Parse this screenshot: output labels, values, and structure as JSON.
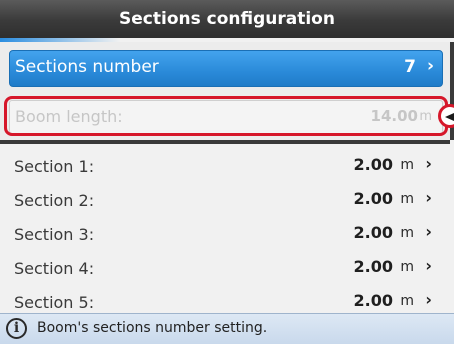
{
  "header": {
    "title": "Sections configuration"
  },
  "sections_number": {
    "label": "Sections number",
    "value": "7",
    "chevron": "›"
  },
  "boom_length": {
    "label": "Boom length:",
    "value": "14.00",
    "unit": "m"
  },
  "sections": [
    {
      "label": "Section 1:",
      "value": "2.00",
      "unit": "m",
      "chevron": "›"
    },
    {
      "label": "Section 2:",
      "value": "2.00",
      "unit": "m",
      "chevron": "›"
    },
    {
      "label": "Section 3:",
      "value": "2.00",
      "unit": "m",
      "chevron": "›"
    },
    {
      "label": "Section 4:",
      "value": "2.00",
      "unit": "m",
      "chevron": "›"
    },
    {
      "label": "Section 5:",
      "value": "2.00",
      "unit": "m",
      "chevron": "›"
    }
  ],
  "status": {
    "icon": "info-icon",
    "icon_glyph": "i",
    "text": "Boom's sections number setting."
  },
  "colors": {
    "accent_blue": "#2a8ad9",
    "highlight_red": "#d6172a",
    "header_dark": "#3a3a3a"
  }
}
